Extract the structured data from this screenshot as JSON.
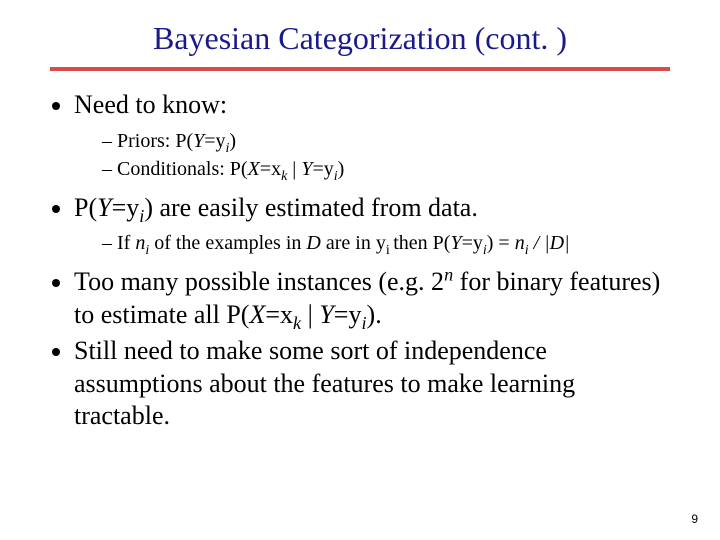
{
  "title": "Bayesian Categorization (cont. )",
  "bullets": {
    "b1": "Need to know:",
    "b1_sub": {
      "s1_pre": "Priors: P(",
      "s1_Y": "Y",
      "s1_eqy": "=y",
      "s1_i": "i",
      "s1_close": ")",
      "s2_pre": "Conditionals: P(",
      "s2_X": "X",
      "s2_eqx": "=x",
      "s2_k": "k",
      "s2_bar": " | ",
      "s2_Y": "Y",
      "s2_eqy": "=y",
      "s2_i": "i",
      "s2_close": ")"
    },
    "b2_pre": "P(",
    "b2_Y": "Y",
    "b2_eqy": "=y",
    "b2_i": "i",
    "b2_rest": ") are easily estimated from data.",
    "b2_sub": {
      "pre": "If ",
      "ni_n": "n",
      "ni_i": "i",
      "mid1": " of the examples in ",
      "D": "D",
      "mid2": " are in y",
      "yi_i": "i ",
      "mid3": "then P(",
      "Y": "Y",
      "eqy": "=y",
      "i": "i",
      "after": ") =  ",
      "frac_n": "n",
      "frac_i": "i",
      "slash": " / |",
      "D2": "D",
      "close": "|"
    },
    "b3_pre": "Too many possible instances (e.g. 2",
    "b3_n": "n",
    "b3_mid": " for binary features) to estimate all P(",
    "b3_X": "X",
    "b3_eqx": "=x",
    "b3_k": "k",
    "b3_bar": " | ",
    "b3_Y": "Y",
    "b3_eqy": "=y",
    "b3_i": "i",
    "b3_end": ").",
    "b4": "Still need to make some sort of independence assumptions about the features to make learning tractable."
  },
  "page_number": "9"
}
